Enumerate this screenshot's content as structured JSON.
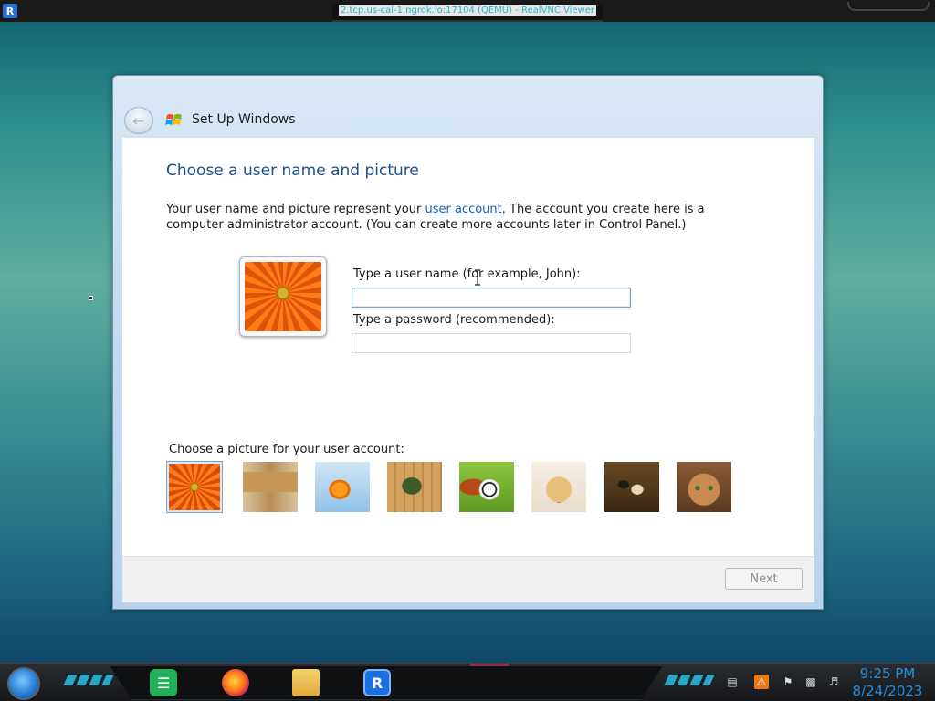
{
  "vnc": {
    "title": "2.tcp.us-cal-1.ngrok.io:17104 (QEMU) - RealVNC Viewer",
    "logo_text": "R"
  },
  "dialog": {
    "title": "Set Up Windows",
    "heading": "Choose a user name and picture",
    "description_before_link": "Your user name and picture represent your ",
    "description_link": "user account",
    "description_after_link": ". The account you create here is a computer administrator account. (You can create more accounts later in Control Panel.)",
    "username_label": "Type a user name (for example, John):",
    "username_value": "",
    "password_label": "Type a password (recommended):",
    "password_value": "",
    "picture_label": "Choose a picture for your user account:",
    "pictures": [
      "flower",
      "robot",
      "goldfish",
      "bonsai",
      "balls",
      "puppy",
      "chess",
      "kitten"
    ],
    "selected_picture": "flower",
    "next_label": "Next"
  },
  "taskbar": {
    "items": [
      "start-orb",
      "notes-icon",
      "firefox-icon",
      "file-manager-icon",
      "realvnc-icon"
    ],
    "tray": [
      "monitor-icon",
      "network-alert-icon",
      "flag-alert-icon",
      "network-icon",
      "volume-icon"
    ],
    "time": "9:25 PM",
    "date": "8/24/2023"
  },
  "colors": {
    "heading": "#1e4f8b",
    "link": "#1f5ea8",
    "clock": "#1f8fe0"
  }
}
